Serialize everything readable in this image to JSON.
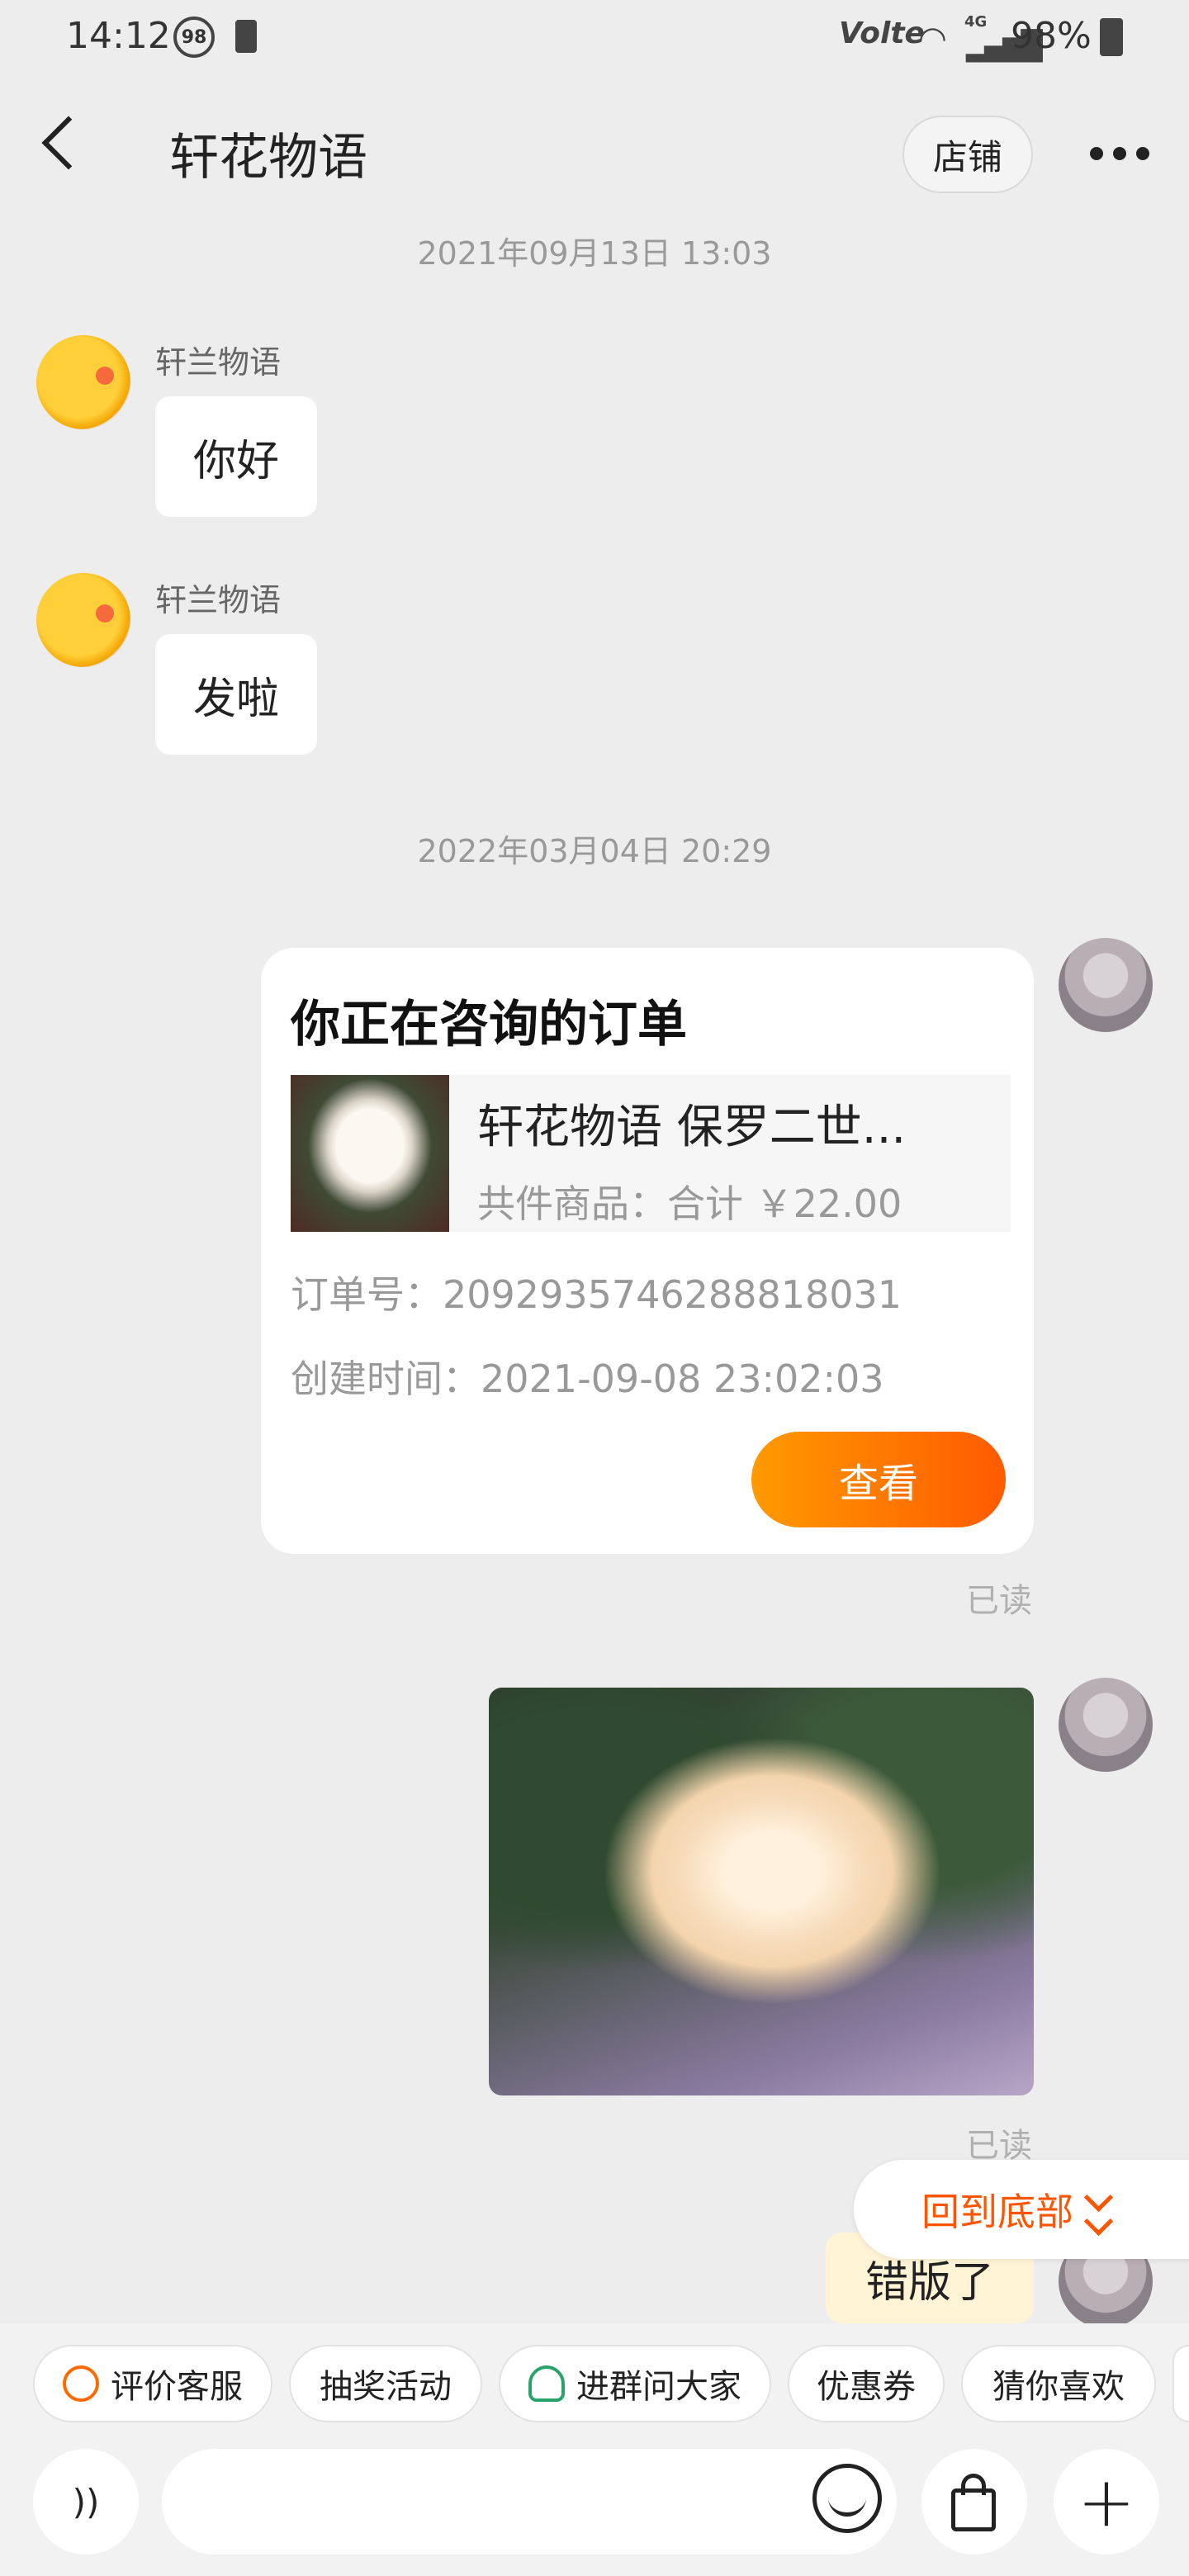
{
  "status_bar": {
    "time": "14:12",
    "badge": "98",
    "network": "Volte",
    "signal": "4G",
    "battery": "98%"
  },
  "header": {
    "title": "轩花物语",
    "shop_button": "店铺"
  },
  "messages": {
    "timestamp_1": "2021年09月13日 13:03",
    "msg_1": {
      "sender": "轩兰物语",
      "text": "你好"
    },
    "msg_2": {
      "sender": "轩兰物语",
      "text": "发啦"
    },
    "timestamp_2": "2022年03月04日 20:29",
    "order_card": {
      "title": "你正在咨询的订单",
      "product_name": "轩花物语 保罗二世...",
      "product_total": "共件商品：合计 ￥22.00",
      "order_no": "订单号：2092935746288818031",
      "created_time": "创建时间：2021-09-08 23:02:03",
      "view_button": "查看"
    },
    "read_1": "已读",
    "read_2": "已读",
    "last_msg": "错版了",
    "back_to_bottom": "回到底部"
  },
  "quick_actions": [
    "评价客服",
    "抽奖活动",
    "进群问大家",
    "优惠券",
    "猜你喜欢"
  ],
  "input": {
    "placeholder": ""
  },
  "colors": {
    "accent": "#ff5500",
    "button_gradient_start": "#ff9a00",
    "button_gradient_end": "#ff5a00"
  }
}
